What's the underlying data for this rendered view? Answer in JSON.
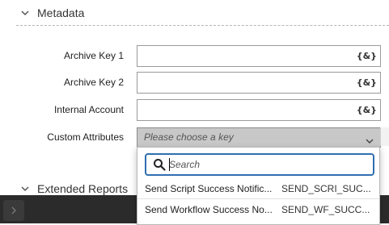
{
  "metadata_section": {
    "title": "Metadata",
    "fields": [
      {
        "label": "Archive Key 1",
        "value": "",
        "var_button": "{&}"
      },
      {
        "label": "Archive Key 2",
        "value": "",
        "var_button": "{&}"
      },
      {
        "label": "Internal Account",
        "value": "",
        "var_button": "{&}"
      }
    ],
    "custom_attributes": {
      "label": "Custom Attributes",
      "placeholder": "Please choose a key"
    }
  },
  "extended_reports_section": {
    "title": "Extended Reports"
  },
  "dropdown": {
    "search_placeholder": "Search",
    "options": [
      {
        "name": "Send Script Success Notific...",
        "code": "SEND_SCRI_SUC..."
      },
      {
        "name": "Send Workflow Success No...",
        "code": "SEND_WF_SUCC..."
      }
    ]
  },
  "icons": {
    "section_toggle": "chevron-down-icon",
    "select_caret": "chevron-down-icon",
    "search": "search-icon"
  },
  "colors": {
    "accent": "#2f6fb0",
    "select_bg": "#c8c8c8",
    "bottom_bar": "#2b2b2b"
  }
}
